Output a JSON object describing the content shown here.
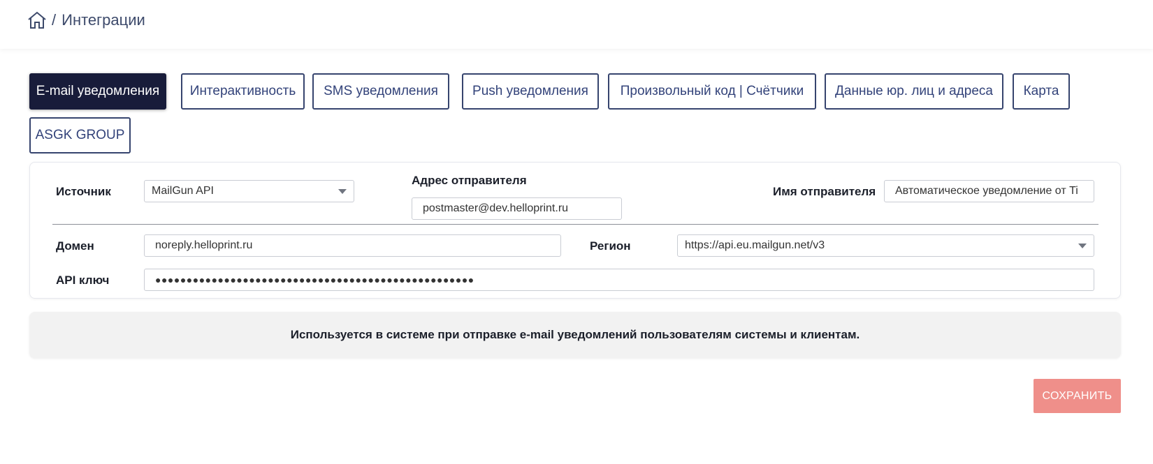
{
  "breadcrumb": {
    "home_icon": "home-icon",
    "separator": "/",
    "current": "Интеграции"
  },
  "tabs": [
    {
      "label": "E-mail уведомления",
      "active": true
    },
    {
      "label": "Интерактивность",
      "active": false
    },
    {
      "label": "SMS уведомления",
      "active": false
    },
    {
      "label": "Push уведомления",
      "active": false
    },
    {
      "label": "Произвольный код | Счётчики",
      "active": false
    },
    {
      "label": "Данные юр. лиц и адреса",
      "active": false
    },
    {
      "label": "Карта",
      "active": false
    },
    {
      "label": "ASGK GROUP",
      "active": false
    }
  ],
  "form": {
    "source": {
      "label": "Источник",
      "value": "MailGun API"
    },
    "sender_address": {
      "label": "Адрес отправителя",
      "value": "postmaster@dev.helloprint.ru"
    },
    "sender_name": {
      "label": "Имя отправителя",
      "value": "Автоматическое уведомление от Ti"
    },
    "domain": {
      "label": "Домен",
      "value": "noreply.helloprint.ru"
    },
    "region": {
      "label": "Регион",
      "value": "https://api.eu.mailgun.net/v3"
    },
    "api_key": {
      "label": "API ключ",
      "value": "●●●●●●●●●●●●●●●●●●●●●●●●●●●●●●●●●●●●●●●●●●●●●●●●●●●"
    }
  },
  "info_text": "Используется в системе при отправке e-mail уведомлений пользователям системы и клиентам.",
  "save_label": "СОХРАНИТЬ",
  "colors": {
    "active_tab": "#181c3a",
    "tab_border": "#36446e",
    "save_button": "#ef8f8a"
  }
}
